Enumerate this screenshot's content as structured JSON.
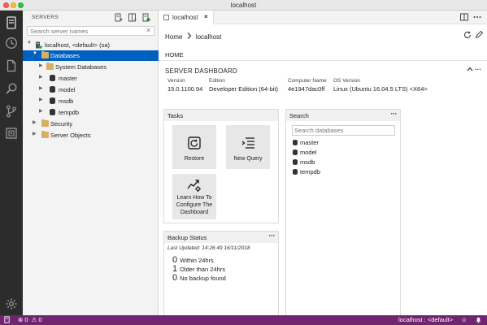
{
  "window": {
    "title": "localhost"
  },
  "activity_bar": {
    "items": [
      {
        "icon": "servers-icon"
      },
      {
        "icon": "history-icon"
      },
      {
        "icon": "file-icon"
      },
      {
        "icon": "search-icon"
      },
      {
        "icon": "source-control-icon"
      },
      {
        "icon": "task-history-icon"
      }
    ],
    "bottom": {
      "icon": "gear-icon"
    }
  },
  "sidebar": {
    "title": "SERVERS",
    "search": {
      "placeholder": "Search server names",
      "value": ""
    },
    "tree": [
      {
        "label": "localhost, <default> (sa)",
        "icon": "server-icon",
        "expanded": true
      },
      {
        "label": "Databases",
        "icon": "folder-icon",
        "expanded": true,
        "selected": true
      },
      {
        "label": "System Databases",
        "icon": "folder-icon"
      },
      {
        "label": "master",
        "icon": "database-icon"
      },
      {
        "label": "model",
        "icon": "database-icon"
      },
      {
        "label": "msdb",
        "icon": "database-icon"
      },
      {
        "label": "tempdb",
        "icon": "database-icon"
      },
      {
        "label": "Security",
        "icon": "folder-icon"
      },
      {
        "label": "Server Objects",
        "icon": "folder-icon"
      }
    ]
  },
  "editor": {
    "tab": {
      "label": "localhost",
      "close": "×"
    },
    "breadcrumb": {
      "items": [
        "Home",
        "localhost"
      ]
    },
    "home_tab": "HOME",
    "dashboard": {
      "title": "SERVER DASHBOARD",
      "more": "···",
      "properties": [
        {
          "key": "Version",
          "value": "15.0.1100.94"
        },
        {
          "key": "Edition",
          "value": "Developer Edition (64-bit)"
        },
        {
          "key": "Computer Name",
          "value": "4e1947dac0ff"
        },
        {
          "key": "OS Version",
          "value": "Linux (Ubuntu 16.04.5 LTS) <X64>"
        }
      ]
    },
    "tasks_widget": {
      "title": "Tasks",
      "more": "···",
      "tasks": [
        {
          "label": "Restore",
          "icon": "restore-icon"
        },
        {
          "label": "New Query",
          "icon": "new-query-icon"
        },
        {
          "label": "Learn How To Configure The Dashboard",
          "label_lines": [
            "Learn How To",
            "Configure The",
            "Dashboard"
          ],
          "icon": "configure-icon"
        }
      ]
    },
    "search_widget": {
      "title": "Search",
      "more": "···",
      "placeholder": "Search databases",
      "databases": [
        "master",
        "model",
        "msdb",
        "tempdb"
      ]
    },
    "backup_widget": {
      "title": "Backup Status",
      "more": "···",
      "last_updated": "Last Updated: 14:26:49 16/11/2018",
      "rows": [
        {
          "count": "0",
          "label": "Within 24hrs"
        },
        {
          "count": "1",
          "label": "Older than 24hrs"
        },
        {
          "count": "0",
          "label": "No backup found"
        }
      ]
    }
  },
  "statusbar": {
    "errors": "0",
    "warnings": "0",
    "connection": "localhost : <default>",
    "color": "#702571"
  }
}
